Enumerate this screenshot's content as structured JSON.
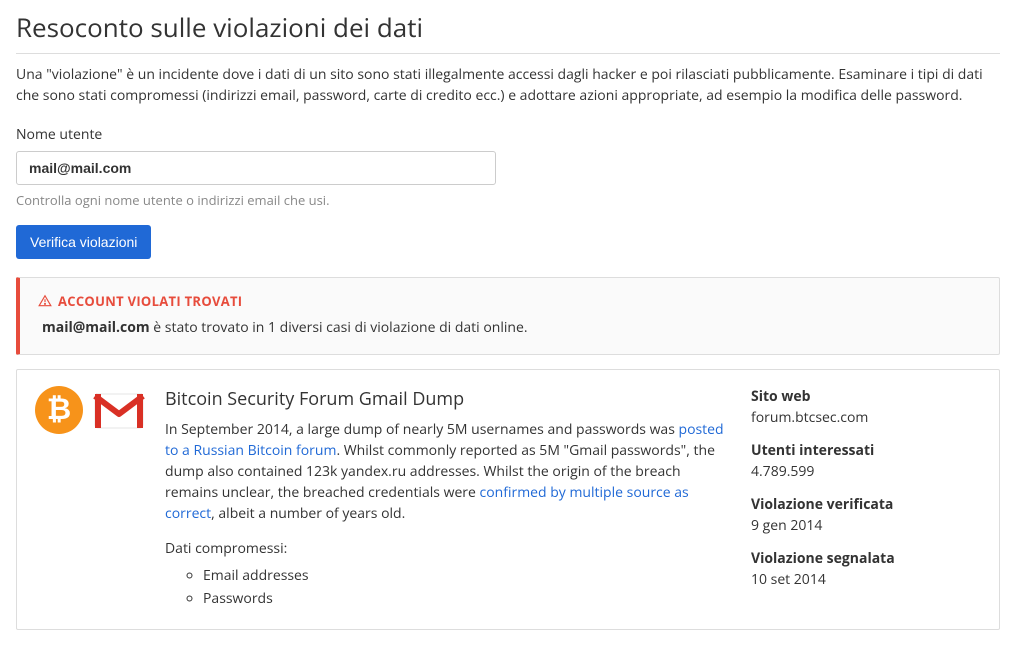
{
  "page": {
    "title": "Resoconto sulle violazioni dei dati",
    "intro": "Una \"violazione\" è un incidente dove i dati di un sito sono stati illegalmente accessi dagli hacker e poi rilasciati pubblicamente. Esaminare i tipi di dati che sono stati compromessi (indirizzi email, password, carte di credito ecc.) e adottare azioni appropriate, ad esempio la modifica delle password."
  },
  "form": {
    "label": "Nome utente",
    "value": "mail@mail.com",
    "help": "Controlla ogni nome utente o indirizzi email che usi.",
    "submit": "Verifica violazioni"
  },
  "alert": {
    "title": "ACCOUNT VIOLATI TROVATI",
    "email": "mail@mail.com",
    "message_suffix": " è stato trovato in 1 diversi casi di violazione di dati online."
  },
  "breach": {
    "title": "Bitcoin Security Forum Gmail Dump",
    "desc_part1": "In September 2014, a large dump of nearly 5M usernames and passwords was ",
    "link1": "posted to a Russian Bitcoin forum",
    "desc_part2": ". Whilst commonly reported as 5M \"Gmail passwords\", the dump also contained 123k yandex.ru addresses. Whilst the origin of the breach remains unclear, the breached credentials were ",
    "link2": "confirmed by multiple source as correct",
    "desc_part3": ", albeit a number of years old.",
    "compromised_label": "Dati compromessi:",
    "compromised": [
      "Email addresses",
      "Passwords"
    ],
    "side": {
      "website_label": "Sito web",
      "website_value": "forum.btcsec.com",
      "affected_label": "Utenti interessati",
      "affected_value": "4.789.599",
      "verified_label": "Violazione verificata",
      "verified_value": "9 gen 2014",
      "reported_label": "Violazione segnalata",
      "reported_value": "10 set 2014"
    }
  }
}
